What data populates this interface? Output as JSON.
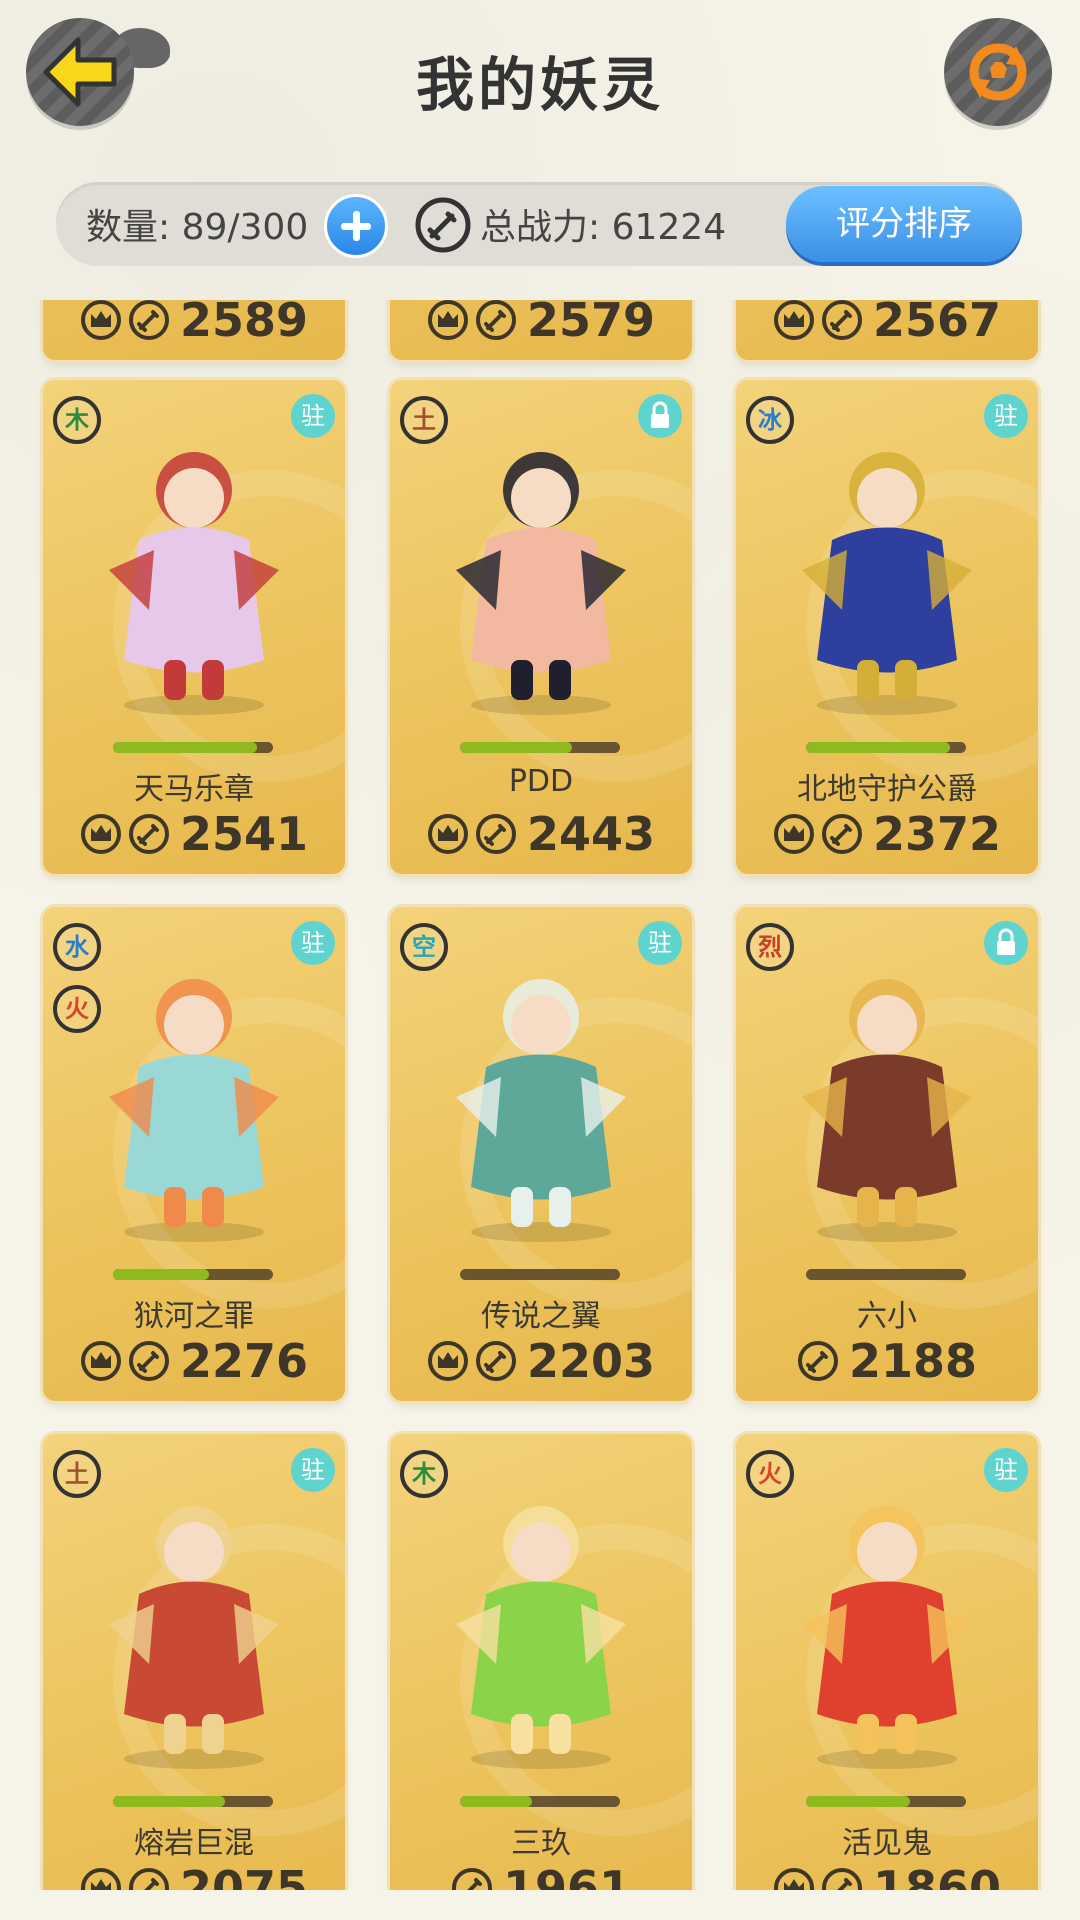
{
  "header": {
    "title": "我的妖灵"
  },
  "info_bar": {
    "count_label": "数量: 89/300",
    "power_label": "总战力: 61224",
    "sort_label": "评分排序"
  },
  "colors": {
    "accent_blue": "#3b8fe6",
    "card_gold": "#ecc45d",
    "hp_green": "#8fba1f",
    "back_arrow": "#f8d61c",
    "refresh_orange": "#f28a1e"
  },
  "top_row_partial": [
    {
      "power": "2589"
    },
    {
      "power": "2579"
    },
    {
      "power": "2567"
    }
  ],
  "cards": [
    {
      "name": "天马乐章",
      "power": "2541",
      "elements": [
        {
          "char": "木",
          "color": "#2e8b3d"
        }
      ],
      "tag": "驻",
      "tag_icon": "station-badge",
      "show_crown": true,
      "hp": 0.9,
      "art_color": "#e8c8e8",
      "art_accent": "#c23a3a"
    },
    {
      "name": "PDD",
      "power": "2443",
      "elements": [
        {
          "char": "土",
          "color": "#a0522d"
        }
      ],
      "tag": "",
      "tag_icon": "lock-icon",
      "show_crown": true,
      "hp": 0.7,
      "art_color": "#f2b8a0",
      "art_accent": "#1f1f2e"
    },
    {
      "name": "北地守护公爵",
      "power": "2372",
      "elements": [
        {
          "char": "冰",
          "color": "#2a7ec9"
        }
      ],
      "tag": "驻",
      "tag_icon": "station-badge",
      "show_crown": true,
      "hp": 0.9,
      "art_color": "#2e3f9e",
      "art_accent": "#d4af37"
    },
    {
      "name": "狱河之罪",
      "power": "2276",
      "elements": [
        {
          "char": "水",
          "color": "#2a7ec9"
        },
        {
          "char": "火",
          "color": "#d6452a"
        }
      ],
      "tag": "驻",
      "tag_icon": "station-badge",
      "show_crown": true,
      "hp": 0.6,
      "art_color": "#9ad8d6",
      "art_accent": "#f08a4b"
    },
    {
      "name": "传说之翼",
      "power": "2203",
      "elements": [
        {
          "char": "空",
          "color": "#2aa5b5"
        }
      ],
      "tag": "驻",
      "tag_icon": "station-badge",
      "show_crown": true,
      "hp": 0.0,
      "art_color": "#5ea89a",
      "art_accent": "#e8f0ec"
    },
    {
      "name": "六小",
      "power": "2188",
      "elements": [
        {
          "char": "烈",
          "color": "#c8402a"
        }
      ],
      "tag": "",
      "tag_icon": "lock-icon",
      "show_crown": false,
      "hp": 0.0,
      "art_color": "#7a3b2a",
      "art_accent": "#e5b44a"
    },
    {
      "name": "熔岩巨混",
      "power": "2075",
      "elements": [
        {
          "char": "土",
          "color": "#a0522d"
        }
      ],
      "tag": "驻",
      "tag_icon": "station-badge",
      "show_crown": true,
      "hp": 0.7,
      "art_color": "#c84a34",
      "art_accent": "#f0d290"
    },
    {
      "name": "三玖",
      "power": "1961",
      "elements": [
        {
          "char": "木",
          "color": "#2e8b3d"
        }
      ],
      "tag": "",
      "tag_icon": "",
      "show_crown": false,
      "hp": 0.45,
      "art_color": "#8bd44a",
      "art_accent": "#f7e0a0"
    },
    {
      "name": "活见鬼",
      "power": "1860",
      "elements": [
        {
          "char": "火",
          "color": "#d6452a"
        }
      ],
      "tag": "驻",
      "tag_icon": "station-badge",
      "show_crown": true,
      "hp": 0.65,
      "art_color": "#e0402e",
      "art_accent": "#f4c25a"
    }
  ]
}
